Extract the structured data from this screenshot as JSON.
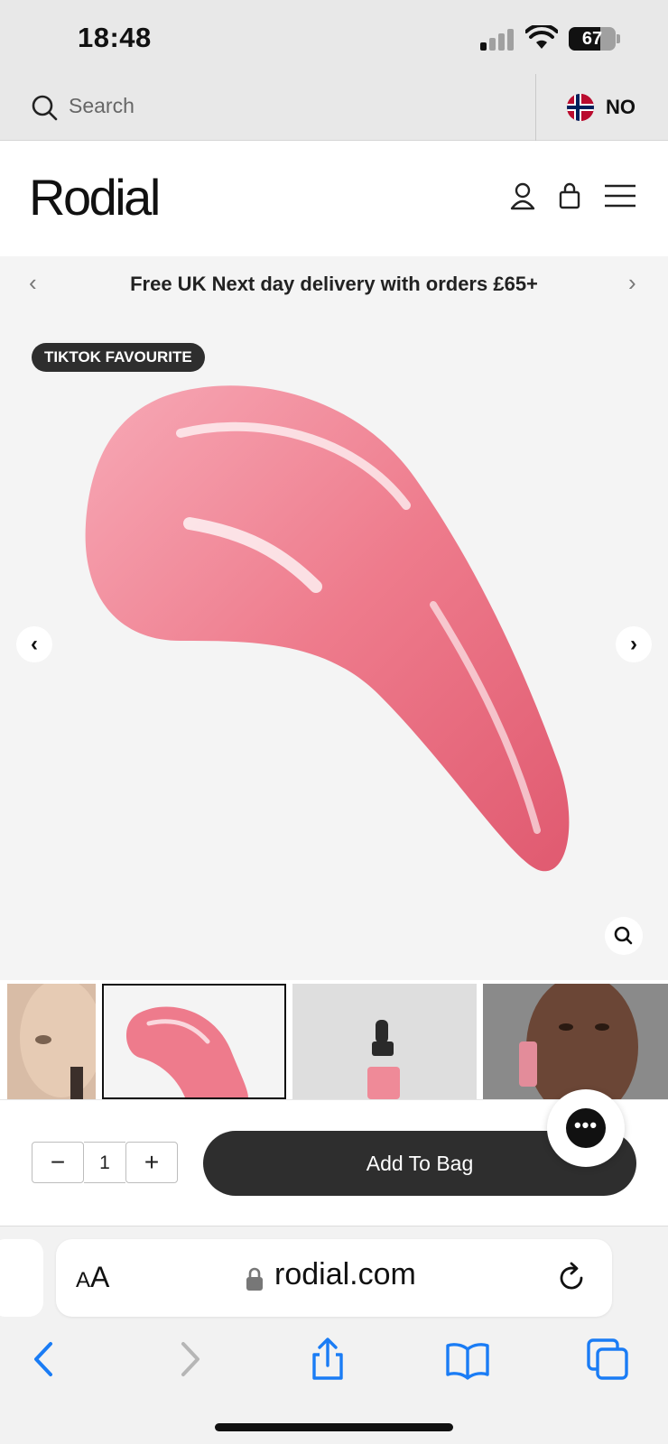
{
  "status_bar": {
    "time": "18:48",
    "battery_percent": "67",
    "battery_level": 0.67
  },
  "search": {
    "placeholder": "Search",
    "region_code": "NO"
  },
  "header": {
    "logo": "Rodial"
  },
  "promo": {
    "text": "Free UK Next day delivery with orders £65+",
    "prev_arrow": "‹",
    "next_arrow": "›"
  },
  "product": {
    "badge": "TIKTOK FAVOURITE",
    "image_prev": "‹",
    "image_next": "›",
    "colors": {
      "swatch_light": "#f7a9b6",
      "swatch_mid": "#ee7b8c",
      "swatch_dark": "#e05a70"
    }
  },
  "purchase": {
    "minus": "−",
    "quantity": "1",
    "plus": "+",
    "add_to_bag": "Add To Bag",
    "chat_dots": "•••"
  },
  "browser": {
    "text_size_label_small": "A",
    "text_size_label_large": "A",
    "url": "rodial.com",
    "accent": "#1a7cf5"
  }
}
